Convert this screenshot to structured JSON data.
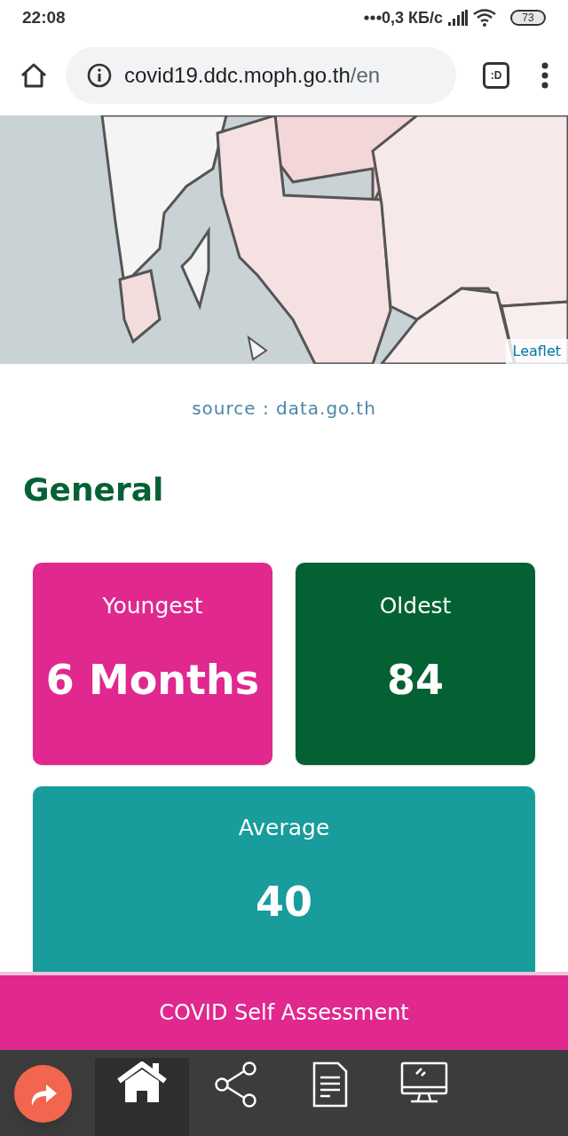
{
  "status_bar": {
    "time": "22:08",
    "speed": "0,3 КБ/с",
    "battery": "73"
  },
  "browser": {
    "host": "covid19.ddc.moph.go.th",
    "path": "/en",
    "tab_label": ":D"
  },
  "map": {
    "attribution": "Leaflet"
  },
  "source": "source : data.go.th",
  "section_title": "General",
  "cards": [
    {
      "label": "Youngest",
      "value": "6 Months",
      "color": "#e0288f"
    },
    {
      "label": "Oldest",
      "value": "84",
      "color": "#046133"
    },
    {
      "label": "Average",
      "value": "40",
      "color": "#189c9c"
    }
  ],
  "assessment_button": "COVID Self Assessment",
  "nav": [
    {
      "kind": "home",
      "selected": true
    },
    {
      "kind": "share",
      "selected": false
    },
    {
      "kind": "document",
      "selected": false
    },
    {
      "kind": "monitor",
      "selected": false
    }
  ]
}
